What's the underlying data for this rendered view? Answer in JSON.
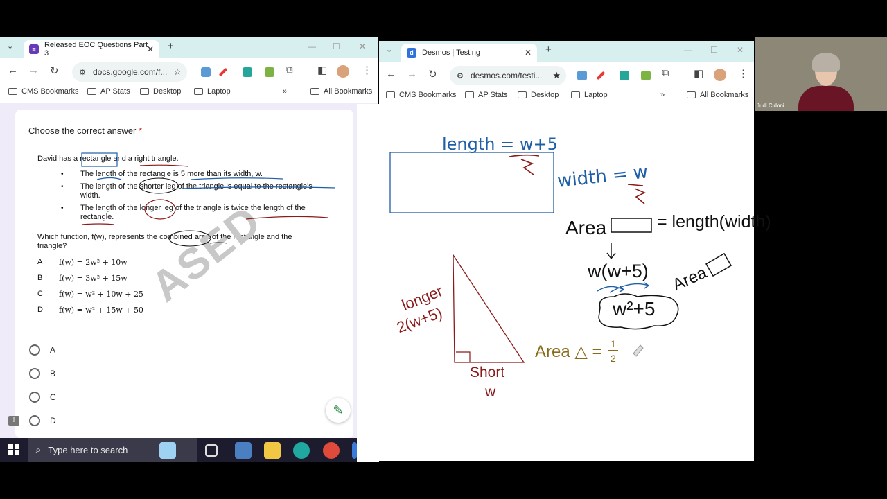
{
  "left_browser": {
    "tab_title": "Released EOC Questions Part 3",
    "address": "docs.google.com/f...",
    "bookmarks": [
      "CMS Bookmarks",
      "AP Stats",
      "Desktop",
      "Laptop"
    ],
    "more": "»",
    "all_bookmarks": "All Bookmarks"
  },
  "right_browser": {
    "tab_title": "Desmos | Testing",
    "address": "desmos.com/testi...",
    "bookmarks": [
      "CMS Bookmarks",
      "AP Stats",
      "Desktop",
      "Laptop"
    ],
    "more": "»",
    "all_bookmarks": "All Bookmarks"
  },
  "form": {
    "question_title": "Choose the correct answer",
    "required_star": "*",
    "intro": "David has a rectangle and a right triangle.",
    "bullets": [
      "The length of the rectangle is 5 more than its width, w.",
      "The length of the shorter leg of the triangle is equal to the rectangle's",
      "width.",
      "The length of the longer leg of the triangle is twice the length of the",
      "rectangle."
    ],
    "prompt_line1": "Which function, f(w), represents the combined area of the rectangle and the",
    "prompt_line2": "triangle?",
    "choices": [
      {
        "letter": "A",
        "expr": "f(w) = 2w² + 10w"
      },
      {
        "letter": "B",
        "expr": "f(w) = 3w² + 15w"
      },
      {
        "letter": "C",
        "expr": "f(w) = w² + 10w + 25"
      },
      {
        "letter": "D",
        "expr": "f(w) = w² + 15w + 50"
      }
    ],
    "watermark": "ASED",
    "options": [
      "A",
      "B",
      "C",
      "D"
    ]
  },
  "whiteboard": {
    "length_label": "length = w+5",
    "width_label": "width = w",
    "area_rect_left": "Area",
    "area_rect_right": "= length(width)",
    "product": "w(w+5)",
    "result": "w²+5",
    "area_word": "Area",
    "longer_label": "longer",
    "longer_expr": "2(w+5)",
    "short_label": "Short",
    "short_var": "w",
    "area_tri": "Area △ = ",
    "half_num": "1",
    "half_den": "2"
  },
  "taskbar": {
    "search_placeholder": "Type here to search"
  },
  "webcam": {
    "name": "Judi Cidoni"
  },
  "colors": {
    "tabbar": "#d8efef",
    "ink_blue": "#1f5fa8",
    "ink_red": "#8b1a1a",
    "ink_black": "#111111",
    "ink_brown": "#8a6a1a",
    "desmos_accent": "#2f72dc",
    "forms_purple": "#673ab7"
  }
}
